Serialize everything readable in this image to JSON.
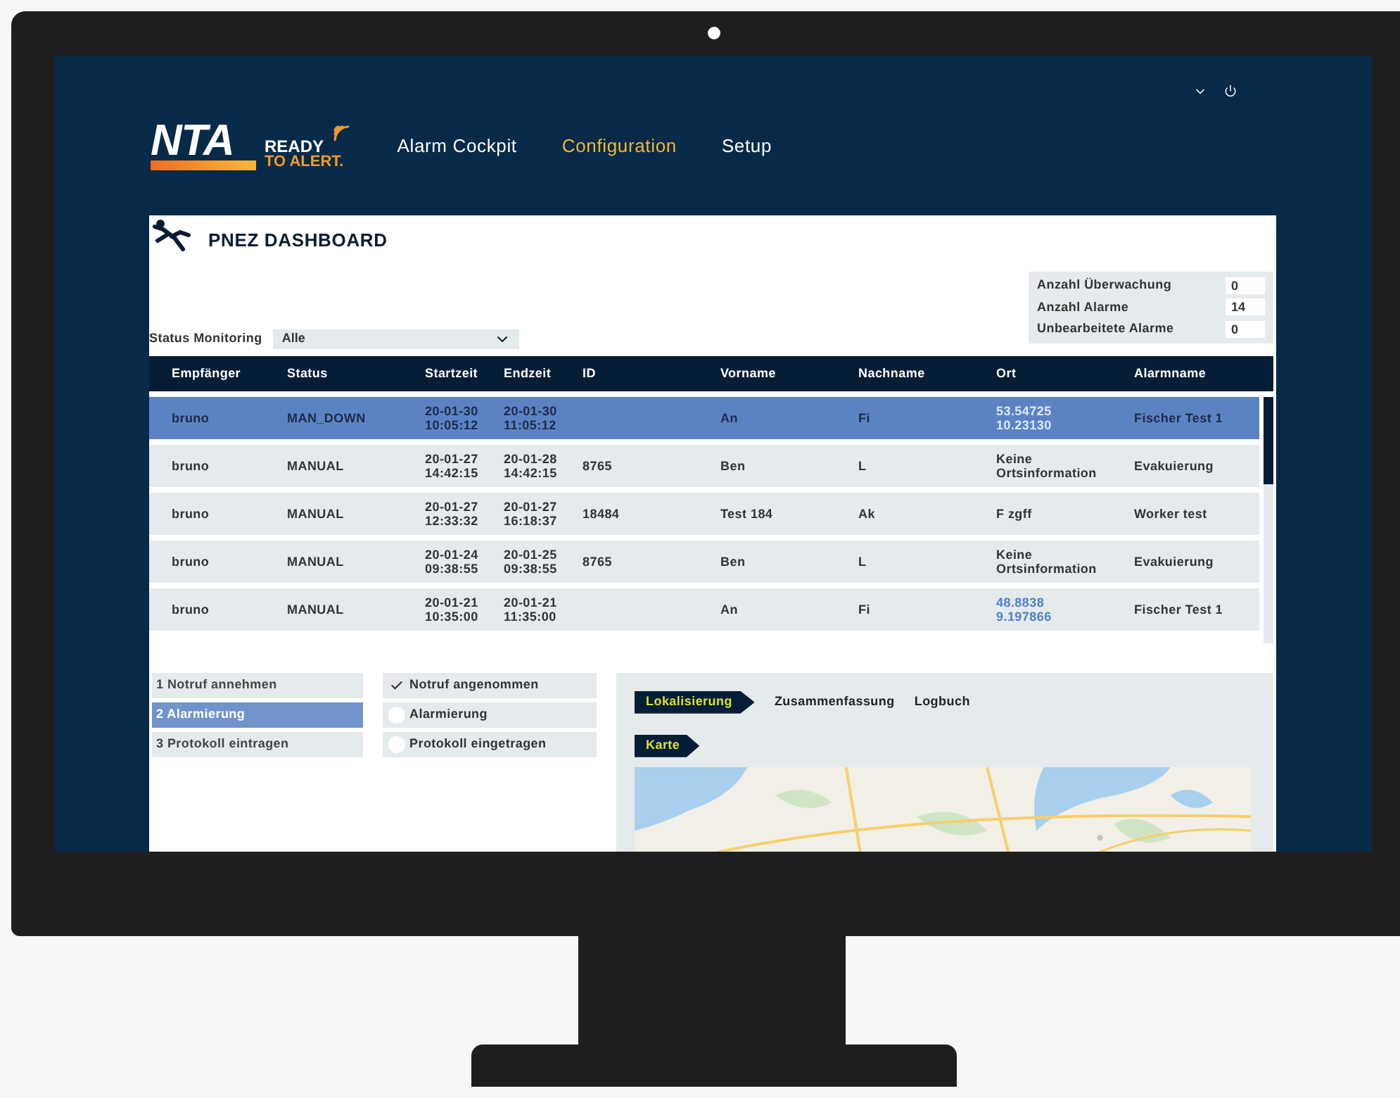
{
  "header": {
    "logo": {
      "mark": "NTA",
      "tagline_top": "READY",
      "tagline_bottom": "TO ALERT."
    },
    "nav": [
      {
        "label": "Alarm Cockpit",
        "selected": false
      },
      {
        "label": "Configuration",
        "selected": true
      },
      {
        "label": "Setup",
        "selected": false
      }
    ]
  },
  "dashboard": {
    "title": "PNEZ DASHBOARD",
    "filter": {
      "label": "Status Monitoring",
      "value": "Alle"
    },
    "stats": [
      {
        "label": "Anzahl Überwachung",
        "value": "0"
      },
      {
        "label": "Anzahl Alarme",
        "value": "14"
      },
      {
        "label": "Unbearbeitete Alarme",
        "value": "0"
      }
    ]
  },
  "table": {
    "columns": [
      "Empfänger",
      "Status",
      "Startzeit",
      "Endzeit",
      "ID",
      "Vorname",
      "Nachname",
      "Ort",
      "Alarmname"
    ],
    "rows": [
      {
        "selected": true,
        "recipient": "bruno",
        "status": "MAN_DOWN",
        "start": "20-01-30 10:05:12",
        "end": "20-01-30 11:05:12",
        "first_name": "An",
        "last_name": "Fi",
        "location": {
          "kind": "coordinates",
          "text": "53.54725 10.23130"
        },
        "alarm_name": "Fischer Test 1"
      },
      {
        "selected": false,
        "recipient": "bruno",
        "status": "MANUAL",
        "start": "20-01-27 14:42:15",
        "end": "20-01-28 14:42:15",
        "id": "8765",
        "first_name": "Ben",
        "last_name": "L",
        "location": {
          "kind": "text",
          "text": "Keine Ortsinformation"
        },
        "alarm_name": "Evakuierung"
      },
      {
        "selected": false,
        "recipient": "bruno",
        "status": "MANUAL",
        "start": "20-01-27 12:33:32",
        "end": "20-01-27 16:18:37",
        "id": "18484",
        "first_name": "Test 184",
        "last_name": "Ak",
        "location": {
          "kind": "text",
          "text": "F zgff"
        },
        "alarm_name": "Worker test"
      },
      {
        "selected": false,
        "recipient": "bruno",
        "status": "MANUAL",
        "start": "20-01-24 09:38:55",
        "end": "20-01-25 09:38:55",
        "id": "8765",
        "first_name": "Ben",
        "last_name": "L",
        "location": {
          "kind": "text",
          "text": "Keine Ortsinformation"
        },
        "alarm_name": "Evakuierung"
      },
      {
        "selected": false,
        "recipient": "bruno",
        "status": "MANUAL",
        "start": "20-01-21 10:35:00",
        "end": "20-01-21 11:35:00",
        "first_name": "An",
        "last_name": "Fi",
        "location": {
          "kind": "coordinates",
          "text": "48.8838 9.197866"
        },
        "alarm_name": "Fischer Test 1"
      }
    ]
  },
  "steps": [
    {
      "label": "1 Notruf annehmen",
      "selected": false
    },
    {
      "label": "2 Alarmierung",
      "selected": true
    },
    {
      "label": "3 Protokoll eintragen",
      "selected": false
    }
  ],
  "checklist": [
    {
      "label": "Notruf angenommen",
      "checked": true
    },
    {
      "label": "Alarmierung",
      "checked": false
    },
    {
      "label": "Protokoll eingetragen",
      "checked": false
    }
  ],
  "details": {
    "tabs": [
      {
        "label": "Lokalisierung",
        "selected": true
      },
      {
        "label": "Zusammenfassung",
        "selected": false
      },
      {
        "label": "Logbuch",
        "selected": false
      }
    ],
    "section": "Karte"
  }
}
